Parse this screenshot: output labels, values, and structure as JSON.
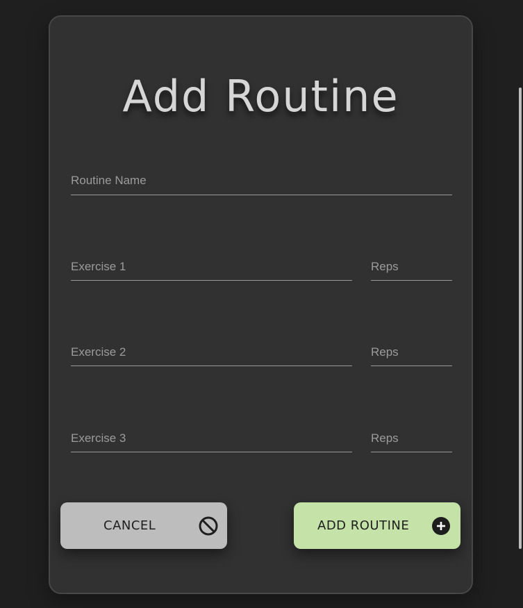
{
  "form": {
    "title": "Add Routine",
    "routine_name": {
      "placeholder": "Routine Name",
      "value": ""
    },
    "exercises": [
      {
        "name_placeholder": "Exercise 1",
        "reps_placeholder": "Reps"
      },
      {
        "name_placeholder": "Exercise 2",
        "reps_placeholder": "Reps"
      },
      {
        "name_placeholder": "Exercise 3",
        "reps_placeholder": "Reps"
      }
    ]
  },
  "actions": {
    "cancel_label": "CANCEL",
    "cancel_icon": "block-icon",
    "add_label": "ADD ROUTINE",
    "add_icon": "add-circle-icon"
  },
  "colors": {
    "background": "#1f1f1f",
    "card": "#313131",
    "cancel_button": "#bdbdbd",
    "add_button": "#c5e3a8"
  }
}
